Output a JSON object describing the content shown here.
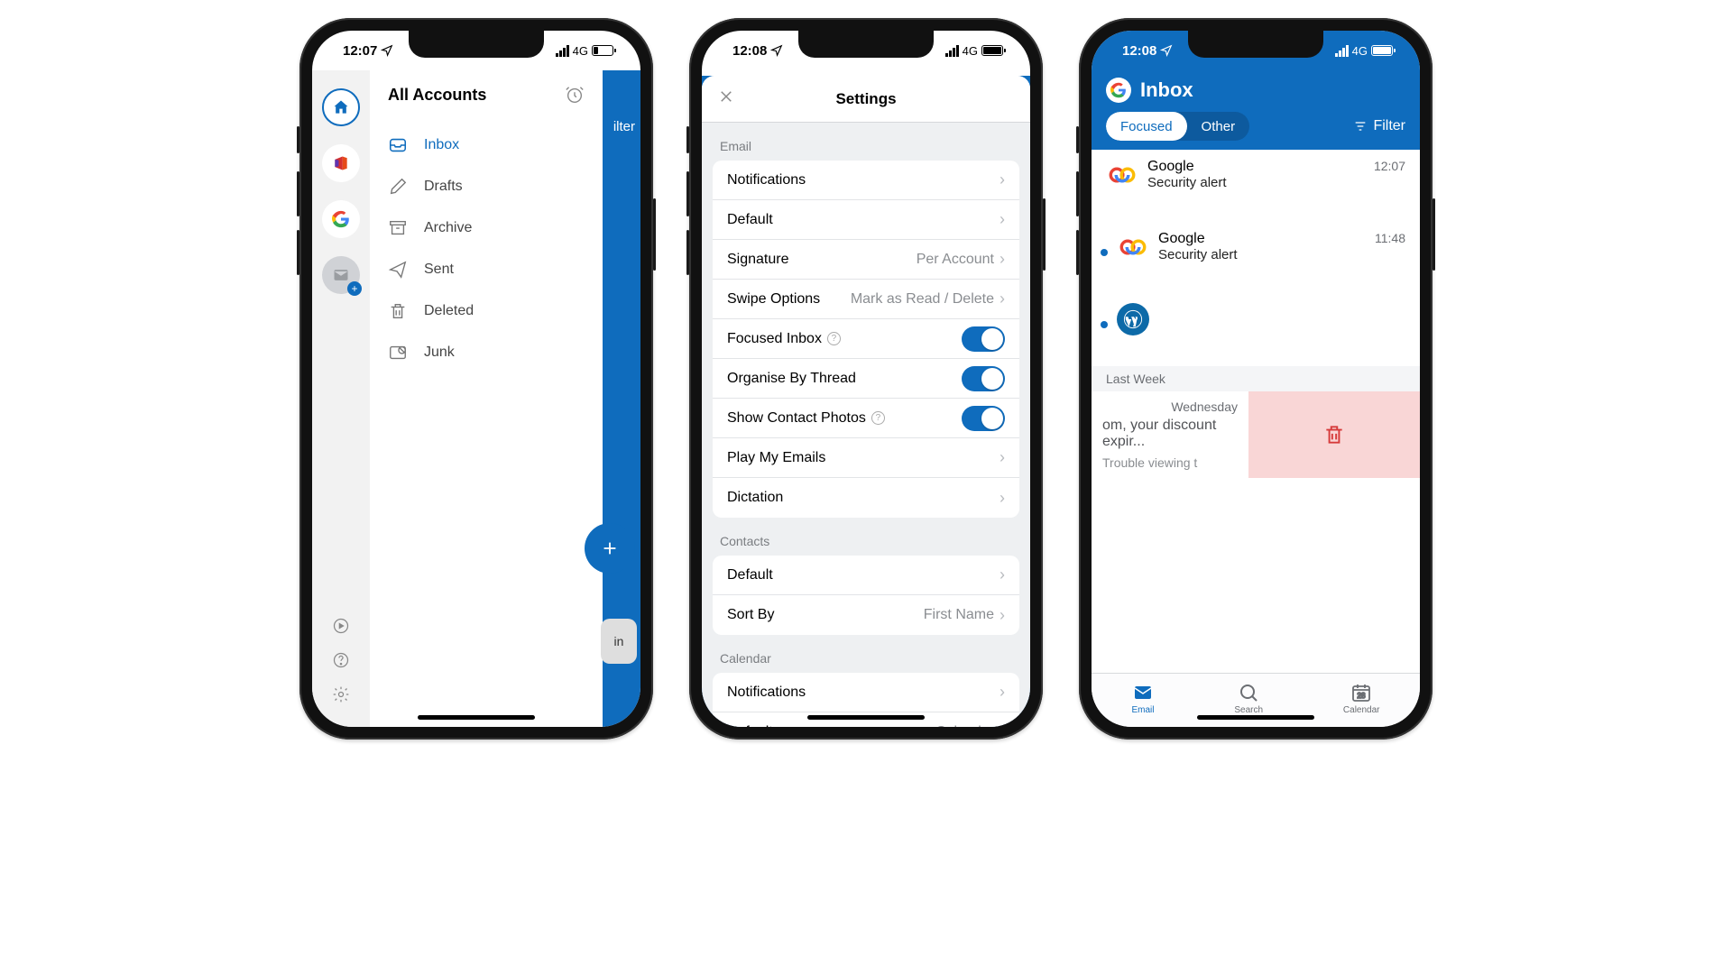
{
  "phone1": {
    "time": "12:07",
    "signal": "4G",
    "header": "All Accounts",
    "folders": {
      "inbox": "Inbox",
      "drafts": "Drafts",
      "archive": "Archive",
      "sent": "Sent",
      "deleted": "Deleted",
      "junk": "Junk"
    },
    "peek_filter": "ilter",
    "snack": "in"
  },
  "phone2": {
    "time": "12:08",
    "signal": "4G",
    "title": "Settings",
    "sections": {
      "email": "Email",
      "contacts": "Contacts",
      "calendar": "Calendar"
    },
    "rows": {
      "notifications": "Notifications",
      "default": "Default",
      "signature": "Signature",
      "signature_val": "Per Account",
      "swipe": "Swipe Options",
      "swipe_val": "Mark as Read / Delete",
      "focused": "Focused Inbox",
      "organise": "Organise By Thread",
      "photos": "Show Contact Photos",
      "play": "Play My Emails",
      "dictation": "Dictation",
      "sortby": "Sort By",
      "sortby_val": "First Name",
      "cal_notif": "Notifications",
      "cal_default": "Default",
      "cal_default_val": "Calendar"
    }
  },
  "phone3": {
    "time": "12:08",
    "signal": "4G",
    "title": "Inbox",
    "tabs": {
      "focused": "Focused",
      "other": "Other"
    },
    "filter": "Filter",
    "msgs": {
      "m1": {
        "sender": "Google",
        "subject": "Security alert",
        "time": "12:07"
      },
      "m2": {
        "sender": "Google",
        "subject": "Security alert",
        "time": "11:48"
      }
    },
    "section_lastweek": "Last Week",
    "swipe": {
      "day": "Wednesday",
      "subject": "om, your discount expir...",
      "preview": "Trouble viewing t"
    },
    "tabbar": {
      "email": "Email",
      "search": "Search",
      "calendar": "Calendar",
      "calnum": "28"
    }
  }
}
